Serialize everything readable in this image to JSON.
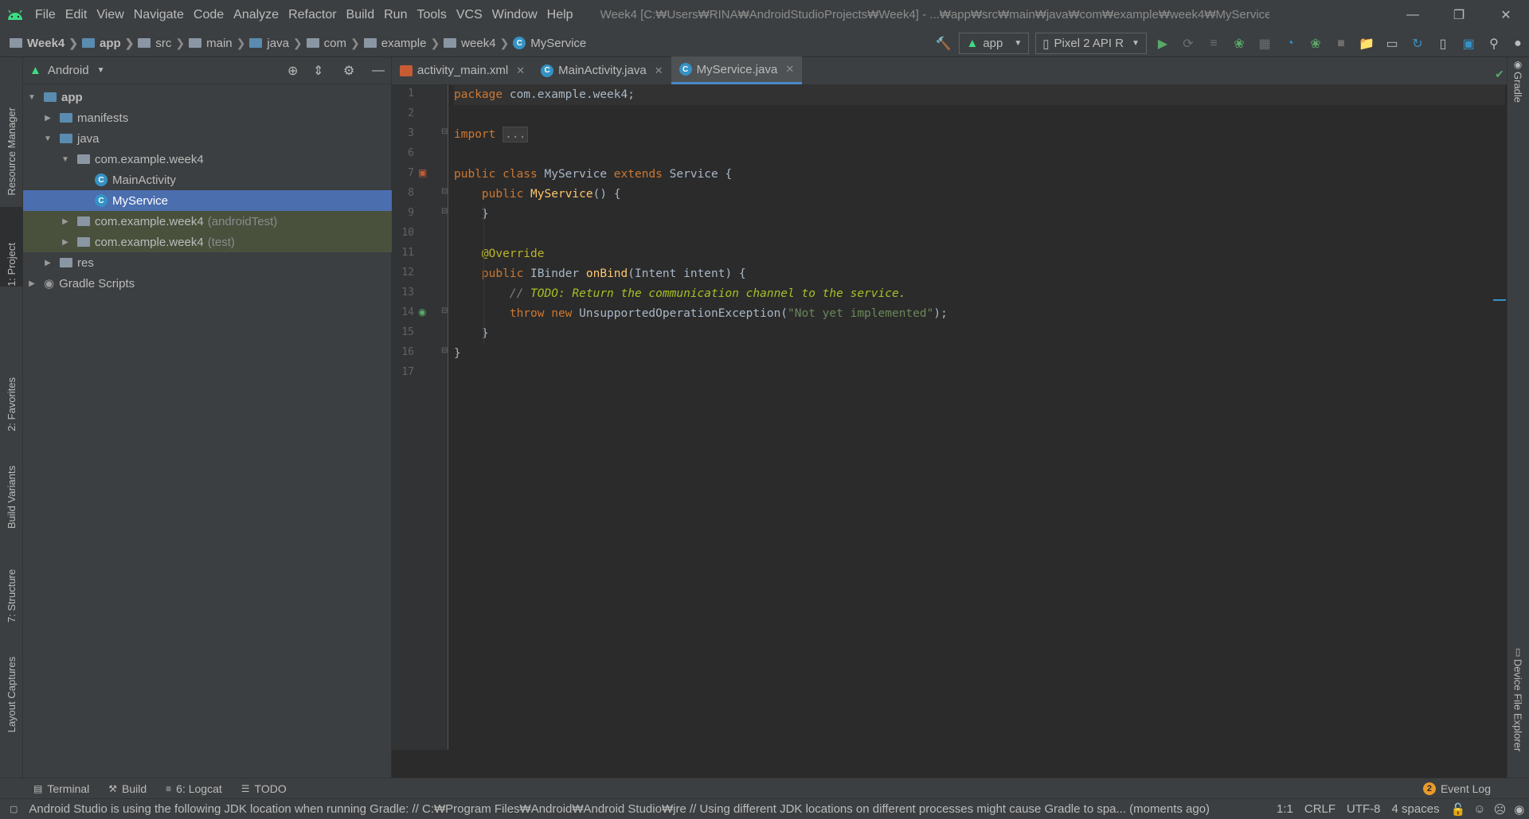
{
  "menubar": {
    "items": [
      "File",
      "Edit",
      "View",
      "Navigate",
      "Code",
      "Analyze",
      "Refactor",
      "Build",
      "Run",
      "Tools",
      "VCS",
      "Window",
      "Help"
    ],
    "window_title": "Week4 [C:₩Users₩RINA₩AndroidStudioProjects₩Week4] - ...₩app₩src₩main₩java₩com₩example₩week4₩MyService.java [app]"
  },
  "breadcrumb": [
    "Week4",
    "app",
    "src",
    "main",
    "java",
    "com",
    "example",
    "week4",
    "MyService"
  ],
  "toolbar": {
    "run_config": "app",
    "device": "Pixel 2 API R"
  },
  "project_panel": {
    "view_mode": "Android",
    "tree": [
      {
        "label": "app",
        "hint": ""
      },
      {
        "label": "manifests",
        "hint": ""
      },
      {
        "label": "java",
        "hint": ""
      },
      {
        "label": "com.example.week4",
        "hint": ""
      },
      {
        "label": "MainActivity",
        "hint": ""
      },
      {
        "label": "MyService",
        "hint": ""
      },
      {
        "label": "com.example.week4",
        "hint": "(androidTest)"
      },
      {
        "label": "com.example.week4",
        "hint": "(test)"
      },
      {
        "label": "res",
        "hint": ""
      },
      {
        "label": "Gradle Scripts",
        "hint": ""
      }
    ]
  },
  "left_tool_tabs": [
    "Resource Manager",
    "1: Project",
    "2: Favorites",
    "Build Variants",
    "7: Structure",
    "Layout Captures"
  ],
  "right_tool_tabs": [
    "Gradle",
    "Device File Explorer"
  ],
  "editor": {
    "tabs": [
      "activity_main.xml",
      "MainActivity.java",
      "MyService.java"
    ],
    "line_numbers": [
      "1",
      "2",
      "3",
      "6",
      "7",
      "8",
      "9",
      "10",
      "11",
      "12",
      "13",
      "14",
      "15",
      "16",
      "17"
    ],
    "code": {
      "l1_kw": "package",
      "l1_rest": " com.example.week4;",
      "l3_kw": "import",
      "l3_fold": "...",
      "l7_a": "public class",
      "l7_b": " MyService ",
      "l7_c": "extends",
      "l7_d": " Service {",
      "l8_a": "    public",
      "l8_b": " MyService",
      "l8_c": "() {",
      "l9": "    }",
      "l11": "    @Override",
      "l12_a": "    public",
      "l12_b": " IBinder ",
      "l12_c": "onBind",
      "l12_d": "(Intent intent) {",
      "l13_a": "        // ",
      "l13_b": "TODO: Return the communication channel to the service.",
      "l14_a": "        throw new",
      "l14_b": " UnsupportedOperationException(",
      "l14_c": "\"Not yet implemented\"",
      "l14_d": ");",
      "l15": "    }",
      "l16": "}"
    }
  },
  "bottom_tools": [
    "Terminal",
    "Build",
    "6: Logcat",
    "TODO"
  ],
  "event_log": {
    "count": "2",
    "label": "Event Log"
  },
  "status": {
    "message": "Android Studio is using the following JDK location when running Gradle: // C:₩Program Files₩Android₩Android Studio₩jre // Using different JDK locations on different processes might cause Gradle to spa... (moments ago)",
    "position": "1:1",
    "line_sep": "CRLF",
    "encoding": "UTF-8",
    "indent": "4 spaces"
  }
}
